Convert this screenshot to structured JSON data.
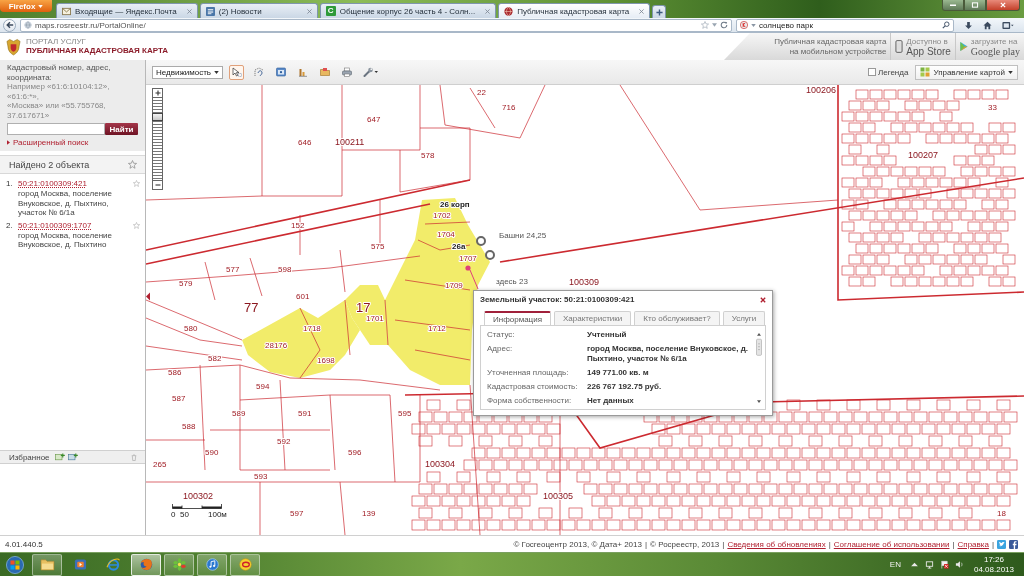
{
  "browser": {
    "menu_button": "Firefox",
    "tabs": [
      {
        "title": "Входящие — Яндекс.Почта",
        "kind": "mail",
        "selected": false
      },
      {
        "title": "(2) Новости",
        "kind": "news",
        "selected": false
      },
      {
        "title": "Общение корпус 26 часть 4 - Солн...",
        "kind": "letter",
        "letter": "C",
        "selected": false
      },
      {
        "title": "Публичная кадастровая карта",
        "kind": "globe",
        "selected": true
      }
    ],
    "url": "maps.rosreestr.ru/PortalOnline/",
    "search": {
      "value": "солнцево парк"
    }
  },
  "header": {
    "portal": "ПОРТАЛ УСЛУГ",
    "title": "ПУБЛИЧНАЯ КАДАСТРОВАЯ КАРТА",
    "mobile_lines": [
      "Публичная кадастровая карта",
      "на мобильном устройстве"
    ],
    "stores": [
      {
        "kind": "apple",
        "small": "Доступно в",
        "label": "App Store"
      },
      {
        "kind": "google",
        "small": "загрузите на",
        "label": "Google play"
      }
    ]
  },
  "toolbar": {
    "category": "Недвижимость",
    "tools": [
      {
        "kind": "pointer",
        "selected": true
      },
      {
        "kind": "area",
        "selected": false
      },
      {
        "kind": "info",
        "selected": false
      },
      {
        "kind": "chart",
        "selected": false
      },
      {
        "kind": "folder",
        "selected": false
      },
      {
        "kind": "print",
        "selected": false
      },
      {
        "kind": "wrench",
        "selected": false
      }
    ],
    "legend": {
      "label": "Легенда",
      "checked": false
    },
    "map_control": "Управление картой"
  },
  "sidebar": {
    "search_label": "Кадастровый номер, адрес, координата:",
    "hints": [
      "Например «61:6:10104:12», «61:6:*»,",
      "«Москва» или «55.755768, 37.617671»"
    ],
    "search_button": "Найти",
    "advanced_search": "Расширенный поиск",
    "results_title": "Найдено 2 объекта",
    "results": [
      {
        "number": "1.",
        "cadastral_number": "50:21:0100309:421",
        "address": "город Москва, поселение Внуковское, д. Пыхтино, участок № 6/1а"
      },
      {
        "number": "2.",
        "cadastral_number": "50:21:0100309:1707",
        "address": "город Москва, поселение Внуковское, д. Пыхтино"
      }
    ],
    "favorites": "Избранное"
  },
  "map": {
    "zoom": {
      "level": 0.8
    },
    "labels": [
      {
        "text": "22",
        "kind": "parcel"
      },
      {
        "text": "100206",
        "kind": "block"
      },
      {
        "text": "716",
        "kind": "parcel"
      },
      {
        "text": "33",
        "kind": "parcel"
      },
      {
        "text": "647",
        "kind": "parcel"
      },
      {
        "text": "646",
        "kind": "parcel"
      },
      {
        "text": "100211",
        "kind": "block"
      },
      {
        "text": "578",
        "kind": "parcel"
      },
      {
        "text": "100207",
        "kind": "block"
      },
      {
        "text": "26 корп",
        "kind": "note"
      },
      {
        "text": "1702",
        "kind": "parcel"
      },
      {
        "text": "152",
        "kind": "parcel"
      },
      {
        "text": "1704",
        "kind": "parcel"
      },
      {
        "text": "Башни 24,25",
        "kind": "caption"
      },
      {
        "text": "575",
        "kind": "parcel"
      },
      {
        "text": "26а",
        "kind": "note"
      },
      {
        "text": "1707",
        "kind": "parcel"
      },
      {
        "text": "577",
        "kind": "parcel"
      },
      {
        "text": "598",
        "kind": "parcel"
      },
      {
        "text": "579",
        "kind": "parcel"
      },
      {
        "text": "1709",
        "kind": "parcel"
      },
      {
        "text": "здесь 23",
        "kind": "caption"
      },
      {
        "text": "100309",
        "kind": "block"
      },
      {
        "text": "601",
        "kind": "parcel"
      },
      {
        "text": "77",
        "kind": "large"
      },
      {
        "text": "17",
        "kind": "large"
      },
      {
        "text": "1701",
        "kind": "parcel"
      },
      {
        "text": "580",
        "kind": "parcel"
      },
      {
        "text": "1718",
        "kind": "parcel"
      },
      {
        "text": "1712",
        "kind": "parcel"
      },
      {
        "text": "28176",
        "kind": "parcel"
      },
      {
        "text": "582",
        "kind": "parcel"
      },
      {
        "text": "1698",
        "kind": "parcel"
      },
      {
        "text": "586",
        "kind": "parcel"
      },
      {
        "text": "594",
        "kind": "parcel"
      },
      {
        "text": "587",
        "kind": "parcel"
      },
      {
        "text": "589",
        "kind": "parcel"
      },
      {
        "text": "591",
        "kind": "parcel"
      },
      {
        "text": "595",
        "kind": "parcel"
      },
      {
        "text": "588",
        "kind": "parcel"
      },
      {
        "text": "592",
        "kind": "parcel"
      },
      {
        "text": "590",
        "kind": "parcel"
      },
      {
        "text": "596",
        "kind": "parcel"
      },
      {
        "text": "265",
        "kind": "parcel"
      },
      {
        "text": "100304",
        "kind": "block"
      },
      {
        "text": "593",
        "kind": "parcel"
      },
      {
        "text": "100302",
        "kind": "block"
      },
      {
        "text": "100305",
        "kind": "block"
      },
      {
        "text": "597",
        "kind": "parcel"
      },
      {
        "text": "139",
        "kind": "parcel"
      },
      {
        "text": "18",
        "kind": "parcel"
      }
    ],
    "scale": [
      "0",
      "50",
      "100м"
    ],
    "popup": {
      "title": "Земельный участок: 50:21:0100309:421",
      "tabs": [
        {
          "label": "Информация",
          "selected": true
        },
        {
          "label": "Характеристики",
          "selected": false
        },
        {
          "label": "Кто обслуживает?",
          "selected": false
        },
        {
          "label": "Услуги",
          "selected": false
        }
      ],
      "rows": [
        {
          "label": "Статус:",
          "value": "Учтенный"
        },
        {
          "label": "Адрес:",
          "value": "город Москва, поселение Внуковское, д. Пыхтино, участок № 6/1а"
        },
        {
          "label": "Уточненная площадь:",
          "value": "149 771.00 кв. м"
        },
        {
          "label": "Кадастровая стоимость:",
          "value": "226 767 192.75 руб."
        },
        {
          "label": "Форма собственности:",
          "value": "Нет данных"
        }
      ]
    }
  },
  "footer": {
    "version": "4.01.440.5",
    "items": [
      {
        "kind": "text",
        "text": "© Госгеоцентр 2013, © Дата+ 2013"
      },
      {
        "kind": "separator",
        "text": "|"
      },
      {
        "kind": "text",
        "text": "© Росреестр, 2013"
      },
      {
        "kind": "separator",
        "text": "|"
      },
      {
        "kind": "link",
        "text": "Сведения об обновлениях"
      },
      {
        "kind": "separator",
        "text": "|"
      },
      {
        "kind": "link",
        "text": "Соглашение об использовании"
      },
      {
        "kind": "separator",
        "text": "|"
      },
      {
        "kind": "link",
        "text": "Справка"
      },
      {
        "kind": "separator",
        "text": "|"
      }
    ]
  },
  "taskbar": {
    "apps": [
      {
        "kind": "explorer",
        "running": true,
        "selected": false
      },
      {
        "kind": "player",
        "running": false,
        "selected": false
      },
      {
        "kind": "ie",
        "running": false,
        "selected": false
      },
      {
        "kind": "firefox",
        "running": true,
        "selected": true
      },
      {
        "kind": "icq",
        "running": true,
        "selected": false
      },
      {
        "kind": "itunes",
        "running": true,
        "selected": false
      },
      {
        "kind": "onec",
        "running": true,
        "selected": false
      }
    ],
    "language": "EN",
    "time": "17:26",
    "date": "04.08.2013"
  }
}
